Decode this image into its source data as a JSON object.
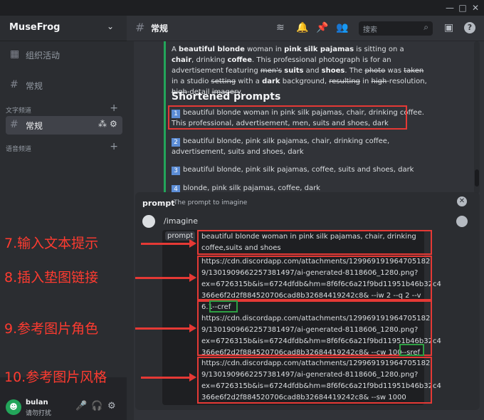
{
  "window": {
    "minimize": "—",
    "maximize": "□",
    "close": "✕"
  },
  "server": {
    "name": "MuseFrog",
    "chevron": "⌄"
  },
  "sidebar": {
    "events": {
      "icon": "▦",
      "label": "组织活动"
    },
    "general_top": {
      "icon": "#",
      "label": "常规"
    },
    "text_category": {
      "label": "文字频道",
      "add": "+"
    },
    "general_active": {
      "icon": "#",
      "label": "常规",
      "settings": "⚙",
      "invite": "⁂"
    },
    "voice_category": {
      "label": "语音频道",
      "add": "+"
    }
  },
  "user": {
    "avatar": "☻",
    "name": "bulan",
    "status": "请勿打扰",
    "mute": "🎤",
    "headset": "🎧",
    "settings": "⚙"
  },
  "topbar": {
    "channel_icon": "#",
    "channel": "常规",
    "search_placeholder": "搜索",
    "search_icon": "⌕",
    "threads": "≋",
    "bell": "🔔",
    "pin": "📌",
    "members": "👥",
    "inbox": "▣",
    "help": "?"
  },
  "message": {
    "para1": {
      "parts": [
        {
          "t": "A "
        },
        {
          "b": "beautiful blonde"
        },
        {
          "t": " woman in "
        },
        {
          "b": "pink silk pajamas"
        },
        {
          "t": " is sitting on a "
        },
        {
          "b": "chair"
        },
        {
          "t": ", drinking "
        },
        {
          "b": "coffee"
        },
        {
          "t": ". This professional photograph is for an advertisement featuring "
        },
        {
          "s": "men's"
        },
        {
          "t": " "
        },
        {
          "b": "suits"
        },
        {
          "t": " and "
        },
        {
          "b": "shoes"
        },
        {
          "t": ". The "
        },
        {
          "s": "photo"
        },
        {
          "t": " was "
        },
        {
          "s": "taken"
        },
        {
          "t": " in a studio "
        },
        {
          "s": "setting"
        },
        {
          "t": " with a "
        },
        {
          "b": "dark"
        },
        {
          "t": " background, "
        },
        {
          "s": "resulting"
        },
        {
          "t": " in "
        },
        {
          "s": "high"
        },
        {
          "t": "-resolution, "
        },
        {
          "s": "high"
        },
        {
          "t": "-detail "
        },
        {
          "s": "imagery"
        },
        {
          "t": "."
        }
      ]
    },
    "heading": "Shortened prompts",
    "items": [
      {
        "n": "1",
        "text": "beautiful blonde woman in pink silk pajamas, chair, drinking coffee. This professional, advertisement, men, suits and shoes, dark"
      },
      {
        "n": "2",
        "text": "beautiful blonde, pink silk pajamas, chair, drinking coffee, advertisement, suits and shoes, dark"
      },
      {
        "n": "3",
        "text": "beautiful blonde, pink silk pajamas, coffee, suits and shoes, dark"
      },
      {
        "n": "4",
        "text": "blonde, pink silk pajamas, coffee, dark"
      }
    ]
  },
  "prompt_panel": {
    "label": "prompt",
    "description": "The prompt to imagine",
    "close": "✕",
    "command": "/imagine",
    "field_name": "prompt",
    "lines": [
      "beautiful blonde woman in pink silk pajamas, chair, drinking",
      "coffee,suits and shoes",
      "https://cdn.discordapp.com/attachments/129969191964705182",
      "9/1301909662257381497/ai-generated-8118606_1280.png?",
      "ex=6726315b&is=6724dfdb&hm=8f6f6c6a21f9bd11951b46b32c4",
      "366e6f2d2f884520706cad8b32684419242c8& --iw 2 --q 2 --v",
      "6.1",
      "--cref",
      "https://cdn.discordapp.com/attachments/129969191964705182",
      "9/1301909662257381497/ai-generated-8118606_1280.png?",
      "ex=6726315b&is=6724dfdb&hm=8f6f6c6a21f9bd11951b46b32c4",
      "366e6f2d2f884520706cad8b32684419242c8& --cw 100",
      "--sref",
      "https://cdn.discordapp.com/attachments/129969191964705182",
      "9/1301909662257381497/ai-generated-8118606_1280.png?",
      "ex=6726315b&is=6724dfdb&hm=8f6f6c6a21f9bd11951b46b32c4",
      "366e6f2d2f884520706cad8b32684419242c8& --sw 1000"
    ]
  },
  "annotations": [
    "7.输入文本提示",
    "8.插入垫图链接",
    "9.参考图片角色",
    "10.参考图片风格"
  ]
}
